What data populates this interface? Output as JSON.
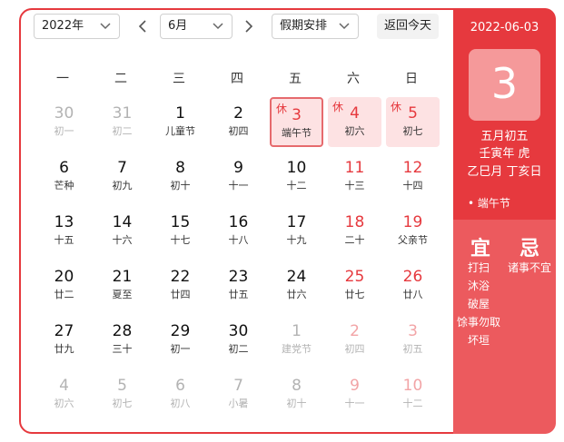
{
  "toolbar": {
    "year": "2022年",
    "month": "6月",
    "holiday_select": "假期安排",
    "today_button": "返回今天"
  },
  "weekdays": [
    "一",
    "二",
    "三",
    "四",
    "五",
    "六",
    "日"
  ],
  "grid": [
    [
      {
        "d": "30",
        "s": "初一",
        "other": true
      },
      {
        "d": "31",
        "s": "初二",
        "other": true
      },
      {
        "d": "1",
        "s": "儿童节"
      },
      {
        "d": "2",
        "s": "初四"
      },
      {
        "d": "3",
        "s": "端午节",
        "tag": "休",
        "holiday": true,
        "selected": true
      },
      {
        "d": "4",
        "s": "初六",
        "tag": "休",
        "holiday": true,
        "weekend": true
      },
      {
        "d": "5",
        "s": "初七",
        "tag": "休",
        "holiday": true,
        "weekend": true
      }
    ],
    [
      {
        "d": "6",
        "s": "芒种"
      },
      {
        "d": "7",
        "s": "初九"
      },
      {
        "d": "8",
        "s": "初十"
      },
      {
        "d": "9",
        "s": "十一"
      },
      {
        "d": "10",
        "s": "十二"
      },
      {
        "d": "11",
        "s": "十三",
        "weekend": true
      },
      {
        "d": "12",
        "s": "十四",
        "weekend": true
      }
    ],
    [
      {
        "d": "13",
        "s": "十五"
      },
      {
        "d": "14",
        "s": "十六"
      },
      {
        "d": "15",
        "s": "十七"
      },
      {
        "d": "16",
        "s": "十八"
      },
      {
        "d": "17",
        "s": "十九"
      },
      {
        "d": "18",
        "s": "二十",
        "weekend": true
      },
      {
        "d": "19",
        "s": "父亲节",
        "weekend": true
      }
    ],
    [
      {
        "d": "20",
        "s": "廿二"
      },
      {
        "d": "21",
        "s": "夏至"
      },
      {
        "d": "22",
        "s": "廿四"
      },
      {
        "d": "23",
        "s": "廿五"
      },
      {
        "d": "24",
        "s": "廿六"
      },
      {
        "d": "25",
        "s": "廿七",
        "weekend": true
      },
      {
        "d": "26",
        "s": "廿八",
        "weekend": true
      }
    ],
    [
      {
        "d": "27",
        "s": "廿九"
      },
      {
        "d": "28",
        "s": "三十"
      },
      {
        "d": "29",
        "s": "初一"
      },
      {
        "d": "30",
        "s": "初二"
      },
      {
        "d": "1",
        "s": "建党节",
        "other": true
      },
      {
        "d": "2",
        "s": "初四",
        "other": true,
        "weekend": true
      },
      {
        "d": "3",
        "s": "初五",
        "other": true,
        "weekend": true
      }
    ],
    [
      {
        "d": "4",
        "s": "初六",
        "other": true
      },
      {
        "d": "5",
        "s": "初七",
        "other": true
      },
      {
        "d": "6",
        "s": "初八",
        "other": true
      },
      {
        "d": "7",
        "s": "小暑",
        "other": true
      },
      {
        "d": "8",
        "s": "初十",
        "other": true
      },
      {
        "d": "9",
        "s": "十一",
        "other": true,
        "weekend": true
      },
      {
        "d": "10",
        "s": "十二",
        "other": true,
        "weekend": true
      }
    ]
  ],
  "panel": {
    "date": "2022-06-03",
    "day": "3",
    "lunar": "五月初五",
    "year_ganzhi": "壬寅年 虎",
    "month_day_ganzhi": "乙巳月 丁亥日",
    "festival": "• 端午节",
    "yi_label": "宜",
    "ji_label": "忌",
    "yi": [
      "打扫",
      "沐浴",
      "破屋",
      "馀事勿取",
      "坏垣"
    ],
    "ji": [
      "诸事不宜"
    ]
  },
  "colors": {
    "accent": "#e6393e",
    "panel_bottom": "#ec5a5e",
    "holiday_bg": "#fde2e3"
  }
}
